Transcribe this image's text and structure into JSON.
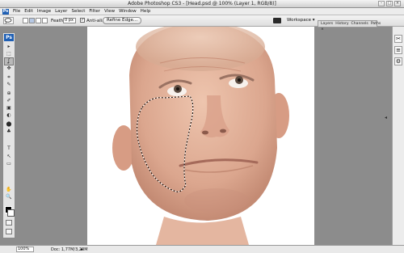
{
  "window": {
    "title": "Adobe Photoshop CS3 - [Head.psd @ 100% (Layer 1, RGB/8)]",
    "controls": [
      "–",
      "□",
      "×"
    ]
  },
  "menu": {
    "logo": "Ps",
    "items": [
      "File",
      "Edit",
      "Image",
      "Layer",
      "Select",
      "Filter",
      "View",
      "Window",
      "Help"
    ]
  },
  "options": {
    "feather_label": "Feather:",
    "feather_value": "0 px",
    "antialias_label": "Anti-alias",
    "antialias_checked": true,
    "refine_edge_label": "Refine Edge...",
    "workspace_label": "Workspace ▾"
  },
  "panel_tabs": [
    "Layers ×",
    "History",
    "Channels",
    "Paths"
  ],
  "toolbox": {
    "logo": "Ps",
    "tools": [
      "▸",
      "⬚",
      "ʆ",
      "✥",
      "⌗",
      "✎",
      "⊕",
      "✐",
      "▣",
      "◐",
      "⬤",
      "♣",
      "T",
      "↖",
      "▭",
      "✋",
      "🔍"
    ]
  },
  "canvas": {
    "document": "Head.psd",
    "layer": "Layer 1",
    "background_color": "#ffffff"
  },
  "right_dock": {
    "icons": [
      "✂",
      "≡",
      "⚙"
    ]
  },
  "status": {
    "zoom": "100%",
    "doc_info": "Doc: 1,77M/3,23M"
  },
  "colors": {
    "accent": "#1e5fb4",
    "workspace_bg": "#8c8c8c"
  }
}
